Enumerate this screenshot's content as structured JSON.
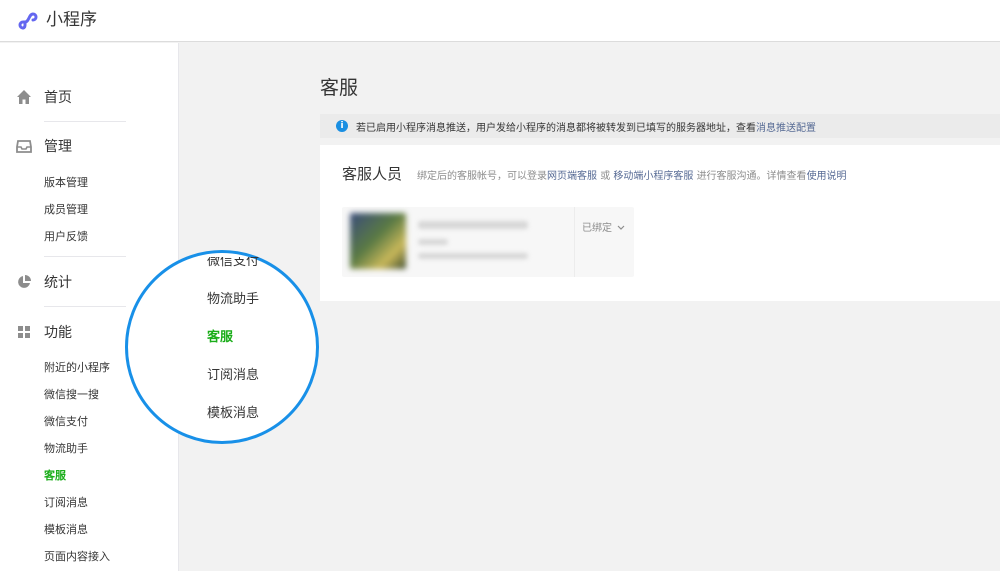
{
  "app": {
    "title": "小程序",
    "logo_icon": "mini-program-logo-icon"
  },
  "colors": {
    "active": "#1aad19",
    "link": "#576b95",
    "callout_ring": "#1890e8",
    "info": "#1a8fe2"
  },
  "sidebar": {
    "sections": [
      {
        "label": "首页",
        "icon": "home-icon",
        "items": []
      },
      {
        "label": "管理",
        "icon": "inbox-icon",
        "items": [
          "版本管理",
          "成员管理",
          "用户反馈"
        ]
      },
      {
        "label": "统计",
        "icon": "pie-chart-icon",
        "items": []
      },
      {
        "label": "功能",
        "icon": "grid-icon",
        "items": [
          "附近的小程序",
          "微信搜一搜",
          "微信支付",
          "物流助手",
          "客服",
          "订阅消息",
          "模板消息",
          "页面内容接入"
        ]
      }
    ],
    "active_item": "客服"
  },
  "callout": {
    "items": [
      "微信支付",
      "物流助手",
      "客服",
      "订阅消息",
      "模板消息"
    ],
    "active_item": "客服"
  },
  "main": {
    "title": "客服",
    "notice": {
      "text": "若已启用小程序消息推送，用户发给小程序的消息都将被转发到已填写的服务器地址，查看",
      "link": "消息推送配置"
    },
    "panel": {
      "title": "客服人员",
      "desc_1": "绑定后的客服帐号，可以登录",
      "link_1": "网页端客服",
      "desc_2": "或",
      "link_2": "移动端小程序客服",
      "desc_3": "进行客服沟通。详情查看",
      "link_3": "使用说明",
      "staff": {
        "status": "已绑定"
      }
    }
  }
}
